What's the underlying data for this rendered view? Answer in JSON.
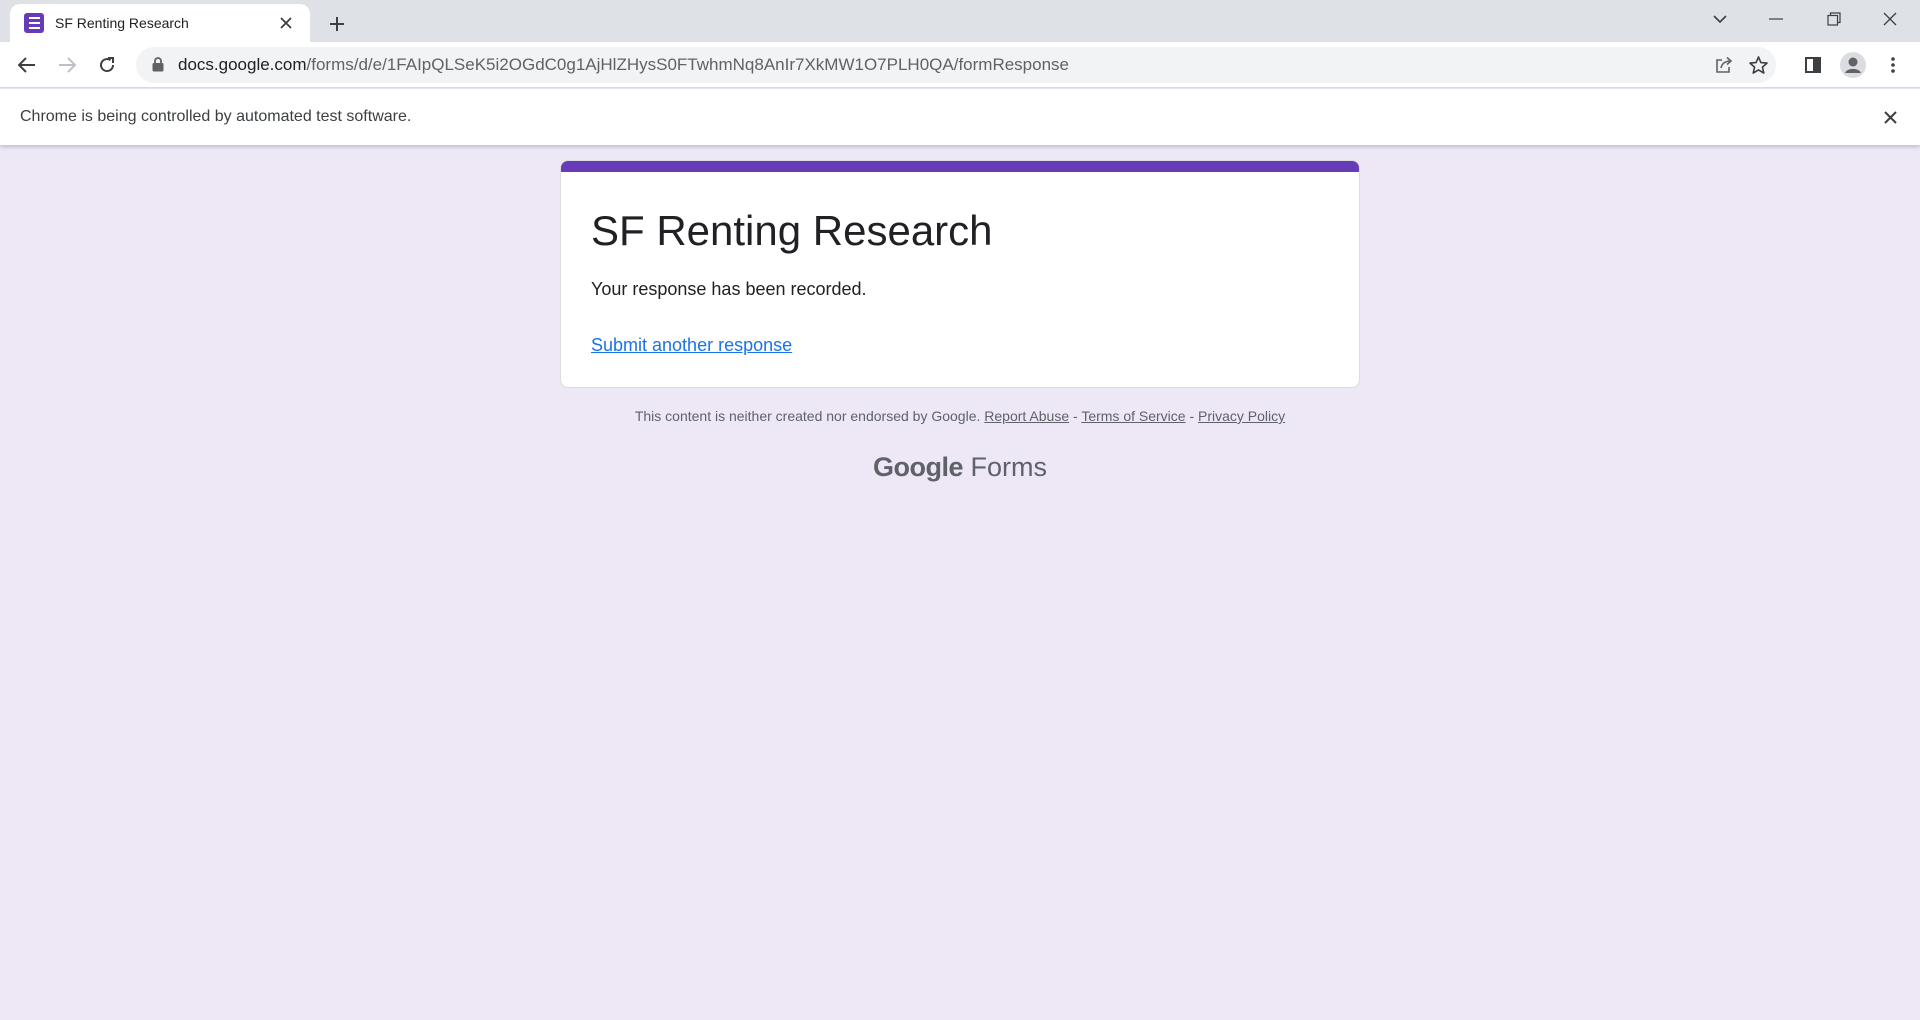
{
  "browser": {
    "tab": {
      "title": "SF Renting Research",
      "favicon": "google-forms-icon"
    },
    "url": {
      "domain": "docs.google.com",
      "path": "/forms/d/e/1FAIpQLSeK5i2OGdC0g1AjHlZHysS0FTwhmNq8AnIr7XkMW1O7PLH0QA/formResponse"
    },
    "infobar": {
      "text": "Chrome is being controlled by automated test software."
    }
  },
  "form": {
    "accent_color": "#673ab7",
    "title": "SF Renting Research",
    "confirmation": "Your response has been recorded.",
    "another_link": "Submit another response"
  },
  "footer": {
    "disclaimer": "This content is neither created nor endorsed by Google.",
    "report_abuse": "Report Abuse",
    "terms": "Terms of Service",
    "privacy": "Privacy Policy",
    "separator": " - ",
    "brand_google": "Google",
    "brand_forms": "Forms"
  }
}
